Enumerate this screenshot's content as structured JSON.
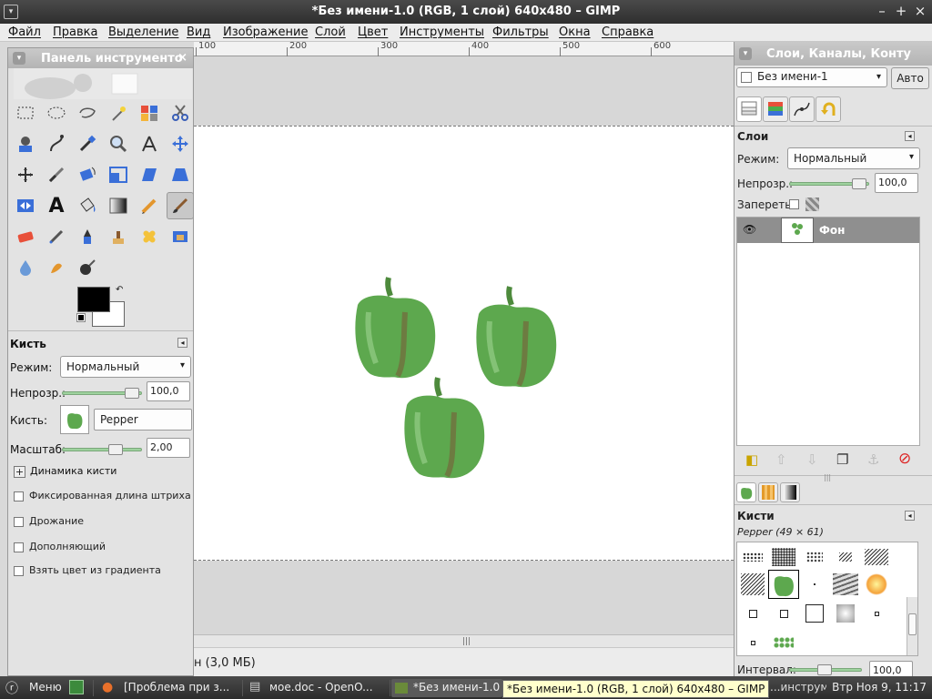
{
  "window": {
    "title": "*Без имени-1.0 (RGB, 1 слой) 640x480 – GIMP",
    "min": "–",
    "max": "+",
    "close": "×"
  },
  "menu": [
    "Файл",
    "Правка",
    "Выделение",
    "Вид",
    "Изображение",
    "Слой",
    "Цвет",
    "Инструменты",
    "Фильтры",
    "Окна",
    "Справка"
  ],
  "ruler": {
    "ticks": [
      "100",
      "200",
      "300",
      "400",
      "500",
      "600",
      "700"
    ]
  },
  "status": {
    "text": "н (3,0 МБ)"
  },
  "toolbox": {
    "title": "Панель инструменто",
    "close": "×",
    "tool_options": {
      "heading": "Кисть",
      "mode_label": "Режим:",
      "mode_value": "Нормальный",
      "opacity_label": "Непрозр.:",
      "opacity_value": "100,0",
      "brush_label": "Кисть:",
      "brush_value": "Pepper",
      "scale_label": "Масштаб:",
      "scale_value": "2,00",
      "dynamics_label": "Динамика кисти",
      "check1": "Фиксированная длина штриха",
      "check2": "Дрожание",
      "check3": "Дополняющий",
      "check4": "Взять цвет из градиента"
    }
  },
  "dock": {
    "title": "Слои, Каналы, Конту",
    "image_select": "Без имени-1",
    "auto_button": "Авто",
    "layers": {
      "heading": "Слои",
      "mode_label": "Режим:",
      "mode_value": "Нормальный",
      "opacity_label": "Непрозр.:",
      "opacity_value": "100,0",
      "lock_label": "Запереть:",
      "layer_name": "Фон"
    },
    "brushes": {
      "heading": "Кисти",
      "current": "Pepper (49 × 61)",
      "spacing_label": "Интервал:",
      "spacing_value": "100,0"
    }
  },
  "taskbar": {
    "menu": "Меню",
    "items": [
      "[Проблема при з...",
      "моe.doc - OpenO...",
      "*Без имени-1.0",
      "...инструм..."
    ],
    "clock": "Втр Ноя  9, 11:17"
  },
  "tooltip": "*Без имени-1.0 (RGB, 1 слой) 640x480 – GIMP",
  "colors": {
    "fg": "#000000",
    "bg": "#ffffff",
    "pepper": "#5da84e"
  }
}
